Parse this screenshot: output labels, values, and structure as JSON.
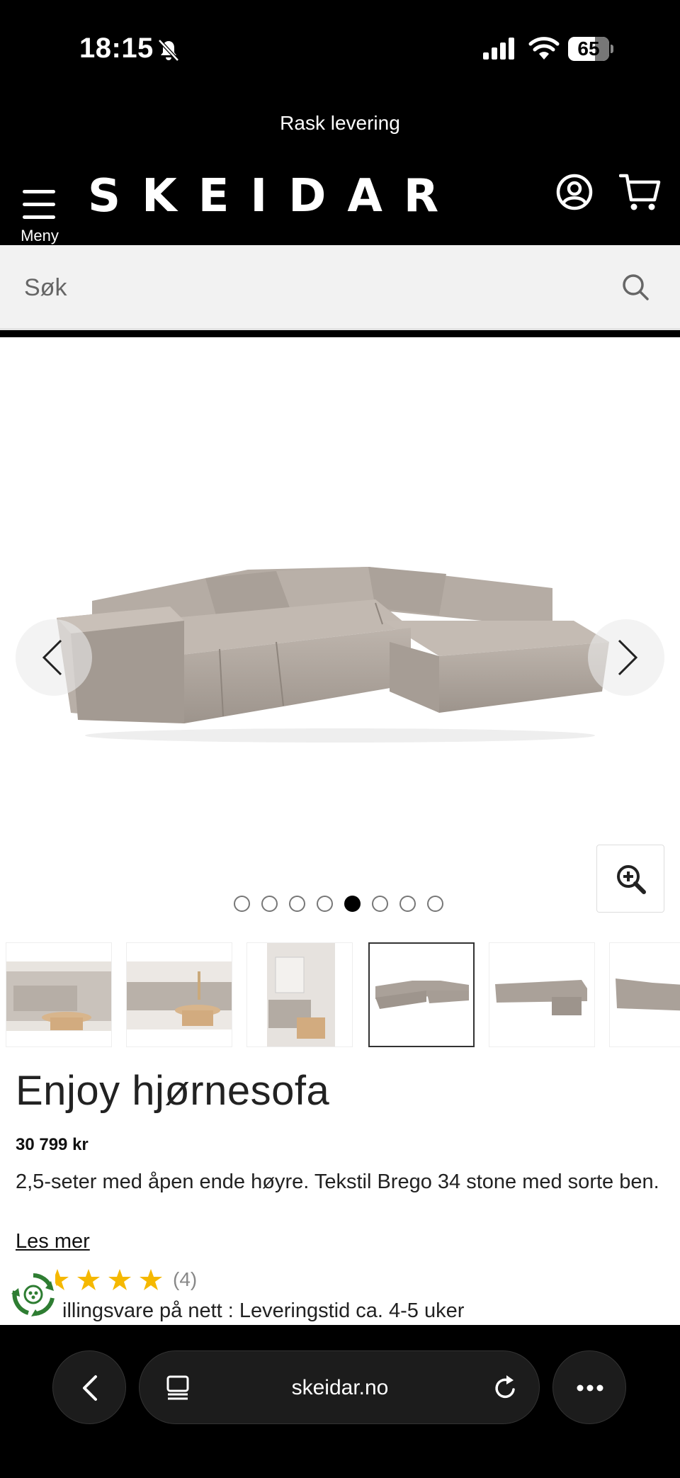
{
  "status": {
    "time": "18:15",
    "battery": "65",
    "battery_level": 0.65
  },
  "promo": {
    "text": "Rask levering"
  },
  "header": {
    "logo": "SKEIDAR",
    "menu_label": "Meny"
  },
  "search": {
    "placeholder": "Søk"
  },
  "gallery": {
    "image_count": 8,
    "active_index": 4,
    "thumbnail_count": 6,
    "selected_thumbnail": 3
  },
  "product": {
    "title": "Enjoy hjørnesofa",
    "price": "30 799 kr",
    "description": "2,5-seter med åpen ende høyre. Tekstil Brego 34 stone med sorte ben.",
    "read_more": "Les mer",
    "rating_count": "(4)",
    "delivery": "illingsvare på nett : Leveringstid ca. 4-5 uker"
  },
  "browser": {
    "url": "skeidar.no"
  },
  "colors": {
    "sofa": "#b0a79f",
    "star": "#f5b800",
    "eco_green": "#2e7d32"
  },
  "icons": [
    "bell-off-icon",
    "signal-icon",
    "wifi-icon",
    "battery-icon",
    "hamburger-icon",
    "account-icon",
    "cart-icon",
    "search-icon",
    "chevron-left-icon",
    "chevron-right-icon",
    "zoom-in-icon",
    "star-icon",
    "recycle-icon",
    "back-icon",
    "tabs-icon",
    "reload-icon",
    "more-icon"
  ]
}
